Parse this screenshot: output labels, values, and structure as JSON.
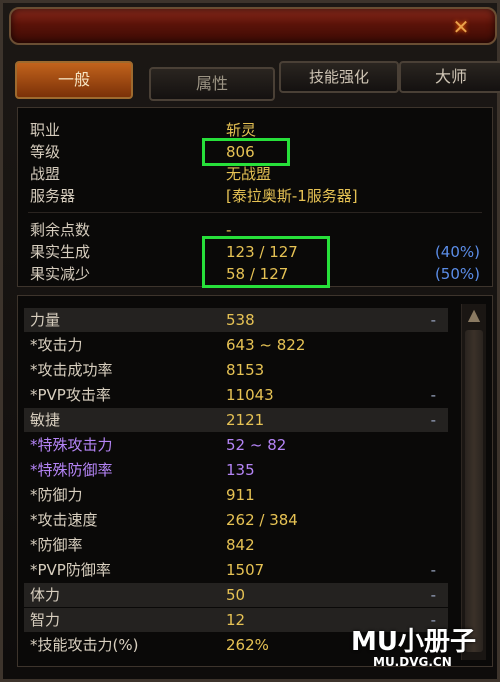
{
  "window": {
    "close_symbol": "✕"
  },
  "tabs": [
    {
      "label": "一般",
      "active": true
    },
    {
      "label": "属性",
      "active": false
    },
    {
      "label": "技能强化",
      "active": false
    },
    {
      "label": "大师",
      "active": false
    }
  ],
  "info": {
    "job_label": "职业",
    "job_value": "斩灵",
    "level_label": "等级",
    "level_value": "806",
    "guild_label": "战盟",
    "guild_value": "无战盟",
    "server_label": "服务器",
    "server_value": "[泰拉奥斯-1服务器]",
    "points_label": "剩余点数",
    "points_value": "-",
    "fruit_gen_label": "果实生成",
    "fruit_gen_value": "123 / 127",
    "fruit_gen_pct": "(40%)",
    "fruit_red_label": "果实减少",
    "fruit_red_value": "58 / 127",
    "fruit_red_pct": "(50%)"
  },
  "stats": [
    {
      "label": "力量",
      "value": "538",
      "dash": "-",
      "head": true
    },
    {
      "label": "*攻击力",
      "value": "643 ~ 822",
      "dash": ""
    },
    {
      "label": "*攻击成功率",
      "value": "8153",
      "dash": ""
    },
    {
      "label": "*PVP攻击率",
      "value": "11043",
      "dash": "-"
    },
    {
      "label": "敏捷",
      "value": "2121",
      "dash": "-",
      "head": true
    },
    {
      "label": "*特殊攻击力",
      "value": "52 ~ 82",
      "dash": "",
      "purple": true
    },
    {
      "label": "*特殊防御率",
      "value": "135",
      "dash": "",
      "purple": true
    },
    {
      "label": "*防御力",
      "value": "911",
      "dash": ""
    },
    {
      "label": "*攻击速度",
      "value": "262 / 384",
      "dash": ""
    },
    {
      "label": "*防御率",
      "value": "842",
      "dash": ""
    },
    {
      "label": "*PVP防御率",
      "value": "1507",
      "dash": "-"
    },
    {
      "label": "体力",
      "value": "50",
      "dash": "-",
      "head": true
    },
    {
      "label": "智力",
      "value": "12",
      "dash": "-",
      "head": true
    },
    {
      "label": "*技能攻击力(%)",
      "value": "262%",
      "dash": ""
    }
  ],
  "watermark": {
    "main": "MU小册子",
    "sub": "MU.DVG.CN"
  },
  "colors": {
    "highlight": "#27e03a",
    "value": "#e6c254",
    "percent": "#5b8de8",
    "special": "#b484f5"
  }
}
